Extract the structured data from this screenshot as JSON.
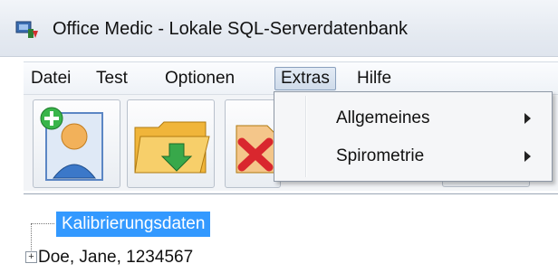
{
  "window": {
    "title": "Office Medic - Lokale SQL-Serverdatenbank",
    "icon": "app-database-icon"
  },
  "menubar": {
    "items": [
      {
        "label": "Datei"
      },
      {
        "label": "Test"
      },
      {
        "label": "Optionen"
      },
      {
        "label": "Extras",
        "active": true
      },
      {
        "label": "Hilfe"
      }
    ]
  },
  "toolbar": {
    "buttons": [
      {
        "icon": "add-patient-icon"
      },
      {
        "icon": "open-folder-icon"
      },
      {
        "icon": "delete-icon"
      }
    ]
  },
  "extras_menu": {
    "items": [
      {
        "label": "Allgemeines",
        "submenu": true
      },
      {
        "label": "Spirometrie",
        "submenu": true
      }
    ]
  },
  "tree": {
    "selected": "Kalibrierungsdaten",
    "nodes": [
      {
        "label": "Doe, Jane, 1234567",
        "expandable": true
      }
    ]
  },
  "colors": {
    "selection": "#3399ff",
    "accent": "#8aa0bd"
  }
}
